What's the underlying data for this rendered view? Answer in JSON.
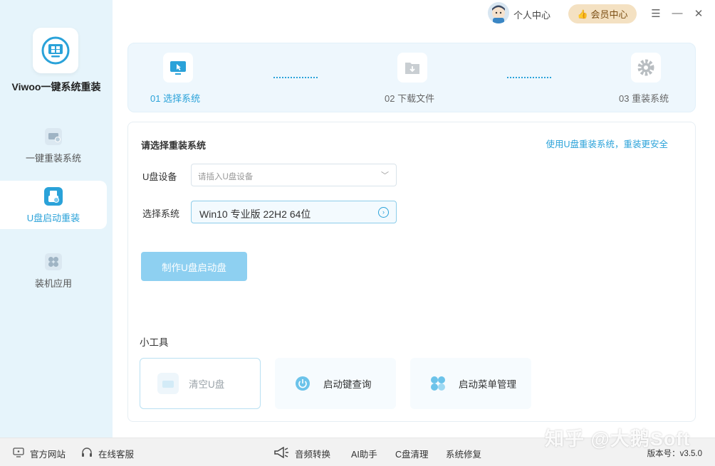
{
  "app": {
    "name": "Viwoo一键系统重装"
  },
  "sidebar": {
    "items": [
      {
        "label": "一键重装系统",
        "icon": "monitor-icon",
        "active": false
      },
      {
        "label": "U盘启动重装",
        "icon": "usb-icon",
        "active": true
      },
      {
        "label": "装机应用",
        "icon": "apps-icon",
        "active": false
      }
    ]
  },
  "header": {
    "personal_label": "个人中心",
    "vip_label": "会员中心"
  },
  "steps": [
    {
      "label": "01 选择系统",
      "icon": "cursor-screen-icon",
      "active": true
    },
    {
      "label": "02 下载文件",
      "icon": "download-icon",
      "active": false
    },
    {
      "label": "03 重装系统",
      "icon": "gear-icon",
      "active": false
    }
  ],
  "panel": {
    "title": "请选择重装系统",
    "link": "使用U盘重装系统，重装更安全",
    "usb_label": "U盘设备",
    "usb_placeholder": "请插入U盘设备",
    "system_label": "选择系统",
    "system_value": "Win10 专业版 22H2 64位",
    "make_button": "制作U盘启动盘"
  },
  "tools": {
    "title": "小工具",
    "items": [
      {
        "label": "清空U盘",
        "icon": "clear-usb-icon"
      },
      {
        "label": "启动键查询",
        "icon": "power-icon"
      },
      {
        "label": "启动菜单管理",
        "icon": "menu-grid-icon"
      }
    ]
  },
  "footer": {
    "website": "官方网站",
    "service": "在线客服",
    "audio": "音频转换",
    "ai": "AI助手",
    "cclean": "C盘清理",
    "repair": "系统修复",
    "version": "版本号：v3.5.0",
    "watermark": "知乎 @大鹅Soft"
  },
  "colors": {
    "accent": "#2aa2d9",
    "sidebar_bg": "#e6f4fb",
    "button_disabled": "#8ed0f1",
    "vip_bg": "#f4e1c2"
  }
}
